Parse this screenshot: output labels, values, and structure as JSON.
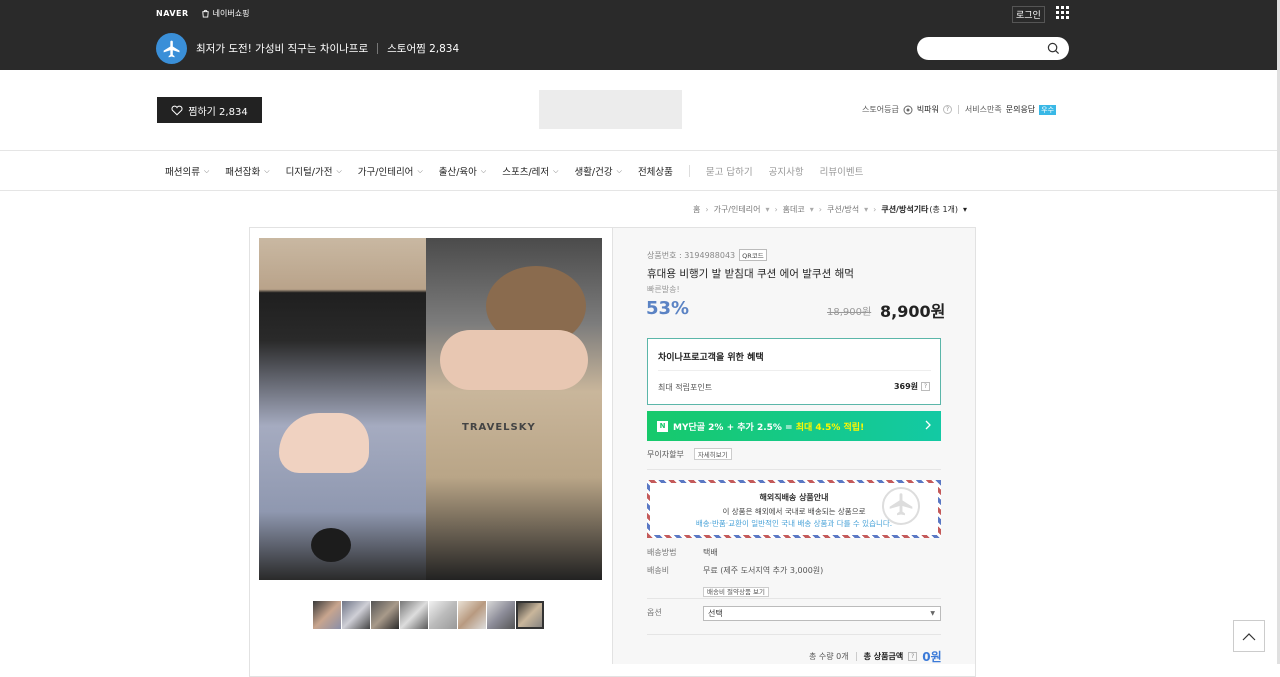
{
  "topbar": {
    "naver": "NAVER",
    "shopping": "네이버쇼핑",
    "login": "로그인",
    "store_name": "최저가 도전! 가성비 직구는 차이나프로",
    "store_fav": "스토어찜 2,834"
  },
  "header": {
    "fav_button": "찜하기 2,834",
    "grade_label": "스토어등급",
    "grade_value": "빅파워",
    "service_label": "서비스만족",
    "service_item": "문의응답",
    "service_badge": "우수"
  },
  "nav": {
    "items": [
      {
        "label": "패션의류",
        "chevron": true
      },
      {
        "label": "패션잡화",
        "chevron": true
      },
      {
        "label": "디지털/가전",
        "chevron": true
      },
      {
        "label": "가구/인테리어",
        "chevron": true
      },
      {
        "label": "출산/육아",
        "chevron": true
      },
      {
        "label": "스포츠/레저",
        "chevron": true
      },
      {
        "label": "생활/건강",
        "chevron": true
      },
      {
        "label": "전체상품",
        "chevron": false
      }
    ],
    "extra": [
      "묻고 답하기",
      "공지사항",
      "리뷰이벤트"
    ]
  },
  "breadcrumb": {
    "items": [
      "홈",
      "가구/인테리어",
      "홈데코",
      "쿠션/방석"
    ],
    "current": "쿠션/방석기타",
    "count": "(총 1개)"
  },
  "product": {
    "id_label": "상품번호 : 3194988043",
    "qr": "QR코드",
    "name": "휴대용 비행기 발 받침대 쿠션 에어 발쿠션 해먹",
    "fast": "빠른발송!",
    "discount": "53%",
    "original_price": "18,900원",
    "price": "8,900원",
    "photo_brand": "TRAVELSKY"
  },
  "benefit": {
    "title": "차이나프로고객을 위한 혜택",
    "points_label": "최대 적립포인트",
    "points_value": "369원"
  },
  "promo": {
    "n": "N",
    "text_a": "MY단골 2% + 추가 2.5% = ",
    "text_b": "최대 4.5% 적립!"
  },
  "interest_free": {
    "label": "무이자할부",
    "button": "자세히보기"
  },
  "overseas": {
    "title": "해외직배송 상품안내",
    "line1": "이 상품은 해외에서 국내로 배송되는 상품으로",
    "line2": "배송·반품·교환이 일반적인 국내 배송 상품과 다를 수 있습니다."
  },
  "shipping": {
    "method_label": "배송방법",
    "method_value": "택배",
    "fee_label": "배송비",
    "fee_value": "무료 (제주 도서지역 추가 3,000원)",
    "fee_button": "배송비 절약상품 보기"
  },
  "option": {
    "label": "옵션",
    "selected": "선택"
  },
  "total": {
    "qty": "총 수량 0개",
    "label": "총 상품금액",
    "amount": "0원"
  },
  "colors": {
    "topbar": "#2a2a2a",
    "discount": "#5b83c4",
    "promo_green": "#17c96b",
    "benefit_border": "#5bb6a9",
    "total_blue": "#3b7ad8"
  }
}
